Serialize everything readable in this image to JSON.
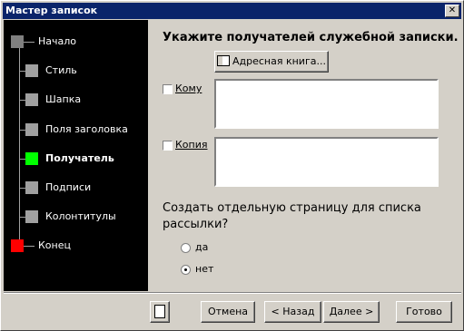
{
  "window": {
    "title": "Мастер записок",
    "close_glyph": "✕"
  },
  "steps": [
    {
      "label": "Начало",
      "state": "done"
    },
    {
      "label": "Стиль",
      "state": "pending"
    },
    {
      "label": "Шапка",
      "state": "pending"
    },
    {
      "label": "Поля заголовка",
      "state": "pending"
    },
    {
      "label": "Получатель",
      "state": "current"
    },
    {
      "label": "Подписи",
      "state": "pending"
    },
    {
      "label": "Колонтитулы",
      "state": "pending"
    },
    {
      "label": "Конец",
      "state": "end"
    }
  ],
  "colors": {
    "done": "#808080",
    "pending": "#a0a0a0",
    "current": "#00ff00",
    "end": "#ff0000"
  },
  "main": {
    "heading": "Укажите получателей служебной записки.",
    "address_book_label": "Адресная книга...",
    "to": {
      "label": "Кому",
      "checked": false,
      "value": ""
    },
    "cc": {
      "label": "Копия",
      "checked": false,
      "value": ""
    },
    "question": "Создать отдельную страницу для списка рассылки?",
    "options": [
      {
        "label": "да",
        "selected": false
      },
      {
        "label": "нет",
        "selected": true
      }
    ]
  },
  "footer": {
    "cancel": "Отмена",
    "back": "< Назад",
    "next": "Далее >",
    "finish": "Готово"
  }
}
